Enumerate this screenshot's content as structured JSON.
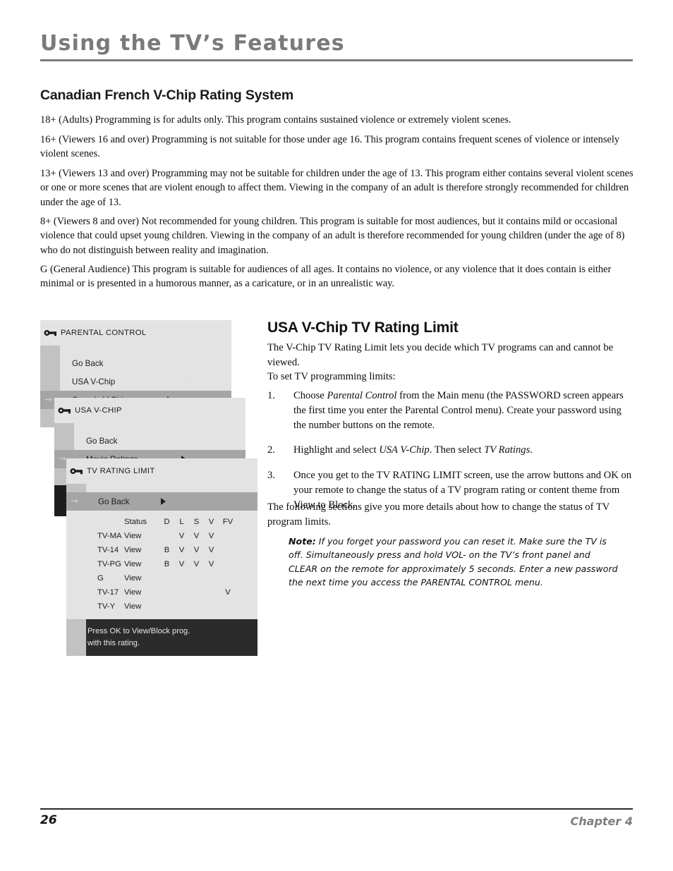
{
  "header": {
    "title": "Using the TV’s Features"
  },
  "sections": {
    "canadian_heading": "Canadian French V-Chip Rating System",
    "usa_heading": "USA V-Chip TV Rating Limit"
  },
  "canadian_paragraphs": {
    "p18": "18+ (Adults) Programming is for adults only. This program contains sustained violence or extremely violent scenes.",
    "p16": "16+ (Viewers 16 and over) Programming is not suitable for those under age 16. This program contains frequent scenes of violence or intensely violent scenes.",
    "p13": "13+ (Viewers 13 and over) Programming may not be suitable for children under the age of 13. This program either contains several violent scenes or one or more scenes that are violent enough to affect them. Viewing in the company of an adult is therefore strongly recommended for children under the age of 13.",
    "p8": "8+ (Viewers 8 and over) Not recommended for young children. This program is suitable for most audiences, but it contains mild or occasional violence that could upset young children. Viewing in the company of an adult is therefore recommended for young children (under the age of 8) who do not distinguish between reality and imagination.",
    "pG": "G (General Audience) This program is suitable for audiences of all ages. It contains no violence, or any violence that it does contain is either minimal or is presented in a humorous manner, as a caricature, or in an unrealistic way."
  },
  "usa_section": {
    "intro": "The V-Chip TV Rating Limit lets you decide which TV programs can and cannot be viewed.",
    "to_set": "To set TV programming limits:",
    "steps": [
      {
        "num": "1.",
        "pre": "Choose ",
        "em1": "Parental Control",
        "mid": " from the Main menu (the PASSWORD screen appears the first time you enter the Parental Control menu). Create your password using the number buttons on the remote.",
        "em2": "",
        "post": ""
      },
      {
        "num": "2.",
        "pre": "Highlight and select ",
        "em1": "USA V-Chip",
        "mid": ". Then select ",
        "em2": "TV Ratings",
        "post": "."
      },
      {
        "num": "3.",
        "pre": "Once you get to the TV RATING LIMIT screen, use the arrow buttons and OK on your remote to change the status of a TV program rating or content theme from View to Block.",
        "em1": "",
        "mid": "",
        "em2": "",
        "post": ""
      }
    ],
    "following": "The following sections give you more details about how to change the status of TV program limits.",
    "note_label": "Note:",
    "note_text": " If you forget your password you can reset it. Make sure the TV is off. Simultaneously press and hold VOL- on the TV’s front panel and CLEAR on the remote for approximately 5 seconds. Enter a new password the next time you access the PARENTAL CONTROL menu."
  },
  "osd": {
    "panel1": {
      "title": "PARENTAL CONTROL",
      "items": [
        {
          "label": "Go Back",
          "selected": false,
          "submenu": false,
          "dots": false
        },
        {
          "label": "USA V-Chip",
          "selected": false,
          "submenu": false,
          "dots": true
        },
        {
          "label": "Canada V-Chip",
          "selected": true,
          "submenu": true,
          "dots": true
        }
      ]
    },
    "panel2": {
      "title": "USA V-CHIP",
      "items": [
        {
          "label": "Go Back",
          "selected": false,
          "submenu": false,
          "dots": false
        },
        {
          "label": "Movie Ratings",
          "selected": true,
          "submenu": true,
          "dots": true
        }
      ]
    },
    "panel3": {
      "title": "TV RATING LIMIT",
      "go_back": {
        "label": "Go Back",
        "selected": true,
        "submenu": true,
        "dots": false
      },
      "table": {
        "columns": [
          "",
          "Status",
          "D",
          "L",
          "S",
          "V",
          "FV"
        ],
        "rows": [
          {
            "rating": "TV-MA",
            "status": "View",
            "D": "",
            "L": "V",
            "S": "V",
            "V": "V",
            "FV": ""
          },
          {
            "rating": "TV-14",
            "status": "View",
            "D": "B",
            "L": "V",
            "S": "V",
            "V": "V",
            "FV": ""
          },
          {
            "rating": "TV-PG",
            "status": "View",
            "D": "B",
            "L": "V",
            "S": "V",
            "V": "V",
            "FV": ""
          },
          {
            "rating": "G",
            "status": "View",
            "D": "",
            "L": "",
            "S": "",
            "V": "",
            "FV": ""
          },
          {
            "rating": "TV-17",
            "status": "View",
            "D": "",
            "L": "",
            "S": "",
            "V": "",
            "FV": "V"
          },
          {
            "rating": "TV-Y",
            "status": "View",
            "D": "",
            "L": "",
            "S": "",
            "V": "",
            "FV": ""
          }
        ]
      },
      "footer_line1": "Press OK to View/Block prog.",
      "footer_line2": "with this rating."
    },
    "icon": "key-icon",
    "colors": {
      "panel_bg": "#e3e3e3",
      "rail": "#c2c2c2",
      "selected_row": "#a5a5a5",
      "footer_bg": "#2b2b2b",
      "title_gray": "#7a7a7a"
    }
  },
  "footer": {
    "page_number": "26",
    "chapter": "Chapter 4"
  }
}
